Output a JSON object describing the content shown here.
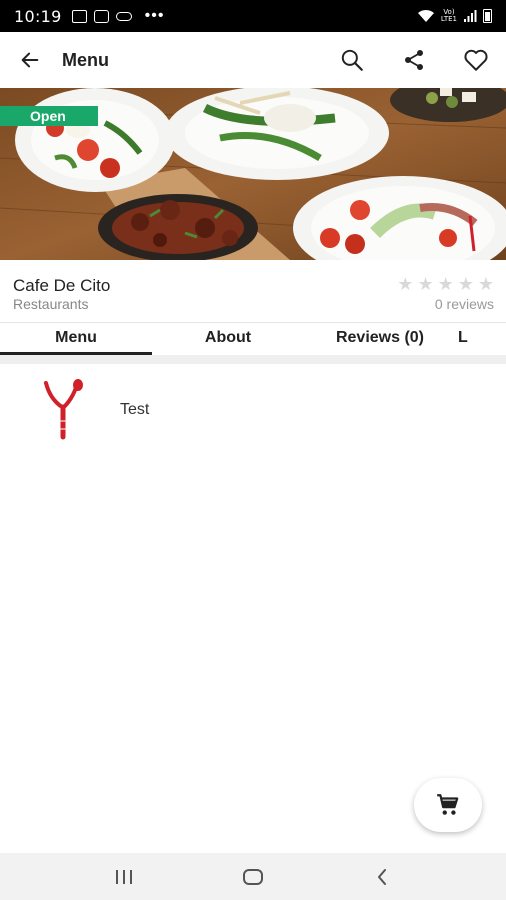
{
  "status_bar": {
    "time": "10:19",
    "lte_top": "Vo)",
    "lte_bottom": "LTE1",
    "overflow_dots": "•••"
  },
  "app_bar": {
    "title": "Menu",
    "icons": [
      "back-arrow-icon",
      "search-icon",
      "share-icon",
      "heart-icon"
    ]
  },
  "hero": {
    "badge": "Open",
    "badge_color": "#1aa86a"
  },
  "store": {
    "name": "Cafe De Cito",
    "category": "Restaurants",
    "rating": 0,
    "rating_max": 5,
    "reviews": "0 reviews"
  },
  "tabs": [
    {
      "label": "Menu",
      "active": true
    },
    {
      "label": "About",
      "active": false
    },
    {
      "label": "Reviews (0)",
      "active": false
    },
    {
      "label": "L",
      "active": false
    }
  ],
  "menu_items": [
    {
      "name": "Test",
      "icon": "fork-logo-icon"
    }
  ],
  "fab": {
    "icon": "cart-icon"
  },
  "nav": {
    "icons": [
      "recent-apps-icon",
      "home-icon",
      "back-icon"
    ]
  },
  "colors": {
    "accent_green": "#1aa86a",
    "logo_red": "#d0202a",
    "star_empty": "#d9d9d9"
  }
}
